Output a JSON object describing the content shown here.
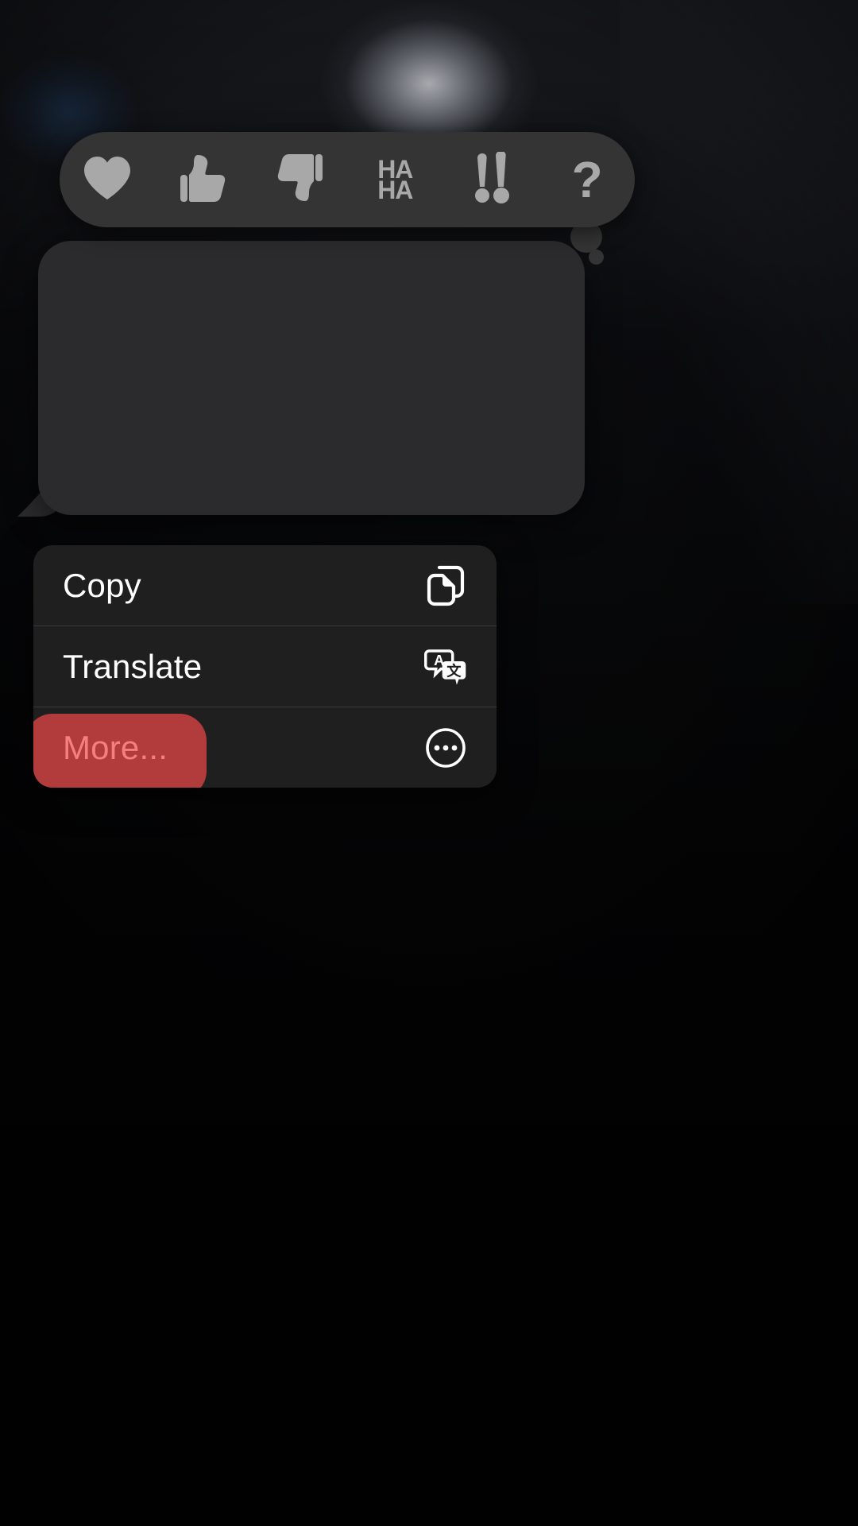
{
  "screen": {
    "title": "Message context menu overlay",
    "background_color": "#000000",
    "backdrop_blurred": true
  },
  "avatar": {
    "name": "contact-avatar",
    "color": "#24405f",
    "blurred": true
  },
  "tapback": {
    "bar_color": "#343434",
    "glyph_color": "#a8a8a8",
    "reactions": [
      {
        "id": "heart",
        "label": "Love",
        "icon": "heart-icon",
        "text": ""
      },
      {
        "id": "thumbsup",
        "label": "Like",
        "icon": "thumbs-up-icon",
        "text": ""
      },
      {
        "id": "thumbsdown",
        "label": "Dislike",
        "icon": "thumbs-down-icon",
        "text": ""
      },
      {
        "id": "haha",
        "label": "Laugh",
        "icon": "haha-icon",
        "text": "HA\nHA"
      },
      {
        "id": "exclaim",
        "label": "Emphasize",
        "icon": "double-exclamation-icon",
        "text": "‼"
      },
      {
        "id": "question",
        "label": "Question",
        "icon": "question-mark-icon",
        "text": "?"
      }
    ]
  },
  "message": {
    "bubble_color": "#2b2b2d",
    "text": "",
    "incoming": true
  },
  "menu": {
    "background_color": "#1f1f1f",
    "separator_color": "#3a3a3a",
    "highlight_color": "#b23b3b",
    "highlight_text_color": "#f3807e",
    "items": [
      {
        "label": "Copy",
        "icon": "copy-icon",
        "highlighted": false
      },
      {
        "label": "Translate",
        "icon": "translate-icon",
        "highlighted": false
      },
      {
        "label": "More...",
        "icon": "ellipsis-circle-icon",
        "highlighted": true
      }
    ]
  }
}
